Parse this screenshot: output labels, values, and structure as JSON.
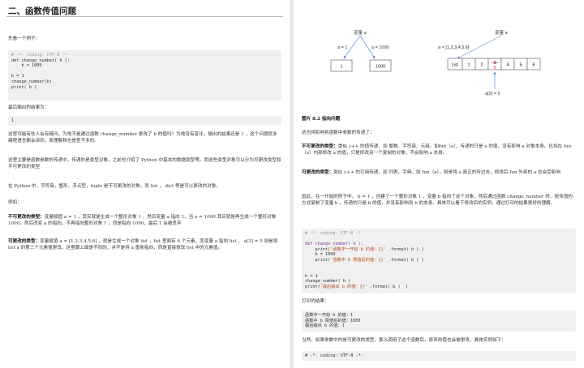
{
  "left": {
    "title": "二、函数传值问题",
    "intro": "先看一个例子：",
    "code1": {
      "comment": "# -*- coding: UTF-8 -*-",
      "lines": [
        "def change_number( b ):",
        "    b = 1000",
        "",
        "b = 1",
        "change_number(b)",
        "print( b )"
      ]
    },
    "result_label": "最后输出的结果为：",
    "result_value": "1",
    "p1": "这里可能有些人会有疑问，为啥不是通过函数 change_number 更改了 b 的值吗？为啥没有变化，输出的结果还是 1 ，这个问题很多编程语言都会讲到，原理解释也是差不多的。",
    "p2": "这里主要是函数参数的传递中，传递的是类型对象，之前也介绍了 Python 中基本的数据类型等。而这些类型对象可以分为可更改类型和不可更改的类型",
    "p3": "在 Python 中，字符串，整形，浮点型，tuple 是不可更改的对象，而 list ， dict 等是可以更改的对象。",
    "p4": "例如：",
    "immut_head": "不可更改的类型：",
    "immut_body": "变量赋值  a = 1 ，其实就是生成一个整形对象 1 ，然后变量 a 指向 1，当 a = 1000 其实就是再生成一个整形对象 1000，然后改变 a 的指向，不再指向整形对象 1 ，而是指向 1000，最后 1 会被丢弃",
    "mut_head": "可更改的类型：",
    "mut_body": "变量赋值  a = [1,2,3,4,5,6] ，就是生成一个对象 list ，list 里面有 6 个元素，而变量 a 指向 list ， a[2] = 5 则是将 list a 的第三个元素值更改，这里跟上面是不同的，并不是将 a 重新指向，而是直接修改 list 中的元素值。"
  },
  "right": {
    "diagram": {
      "var_a_left": "变量 a",
      "a_eq_1": "a = 1",
      "a_eq_1000": "a = 1000",
      "box_1": "1",
      "box_1000": "1000",
      "var_a_right": "变量 a",
      "a_eq_list": "a = [1,2,3,4,5,6]",
      "list_cells": [
        "List",
        "1",
        "2",
        "3",
        "4",
        "5",
        "6"
      ],
      "replaced_value": "5",
      "a2_label": "a[2] = 5"
    },
    "caption": "图片 8.2 指向问题",
    "p1": "这也将影响到函数中参数的传递了：",
    "immut_head": "不可更改的类型：",
    "immut_body": "类似 c++ 的值传递，如 整数、字符串、元组。如fun（a），传递的只是 a 的值，没有影响 a 对象本身。比如在 fun（a）内部修改 a 的值，只是修改另一个复制的对象，不会影响 a 本身。",
    "mut_head": "可更改的类型：",
    "mut_body": "类似 c++ 的引用传递，如 列表，字典。如 fun（a），则是将 a 真正的传过去，修改后 fun 外部的 a 也会受影响",
    "p2": "因此，在一开始的例子中， b = 1 ，创建了一个整形对象 1 ，变量 b 指向了这个对象，然后通过函数 change_number 时，按传值的方式复制了变量 b ，传递的只是 b 的值，并没有影响到 b 的本身。具体可以看下修改后的实例，通过打印的结果更好的理解。",
    "code2": {
      "comment": "# -*- coding: UTF-8 -*-",
      "def_line": "def change_number( b ):",
      "print1_pre": "    print(",
      "print1_str": "'函数中一开始 b 的值：{}'",
      "print1_post": " .format( b ) )",
      "assign": "    b = 1000",
      "print2_pre": "    print(",
      "print2_str": "'函数中 b 赋值后的值：{}'",
      "print2_post": " .format( b ) )",
      "main1": "b = 1",
      "main2": "change_number( b )",
      "print3_pre": "print(",
      "print3_str": "'最后输出 b 的值：{}'",
      "print3_post": " .format( b )  )"
    },
    "out_label": "打印的结果：",
    "output_lines": [
      "函数中一开始 b 的值：1",
      "函数中 b 赋值后的值：1000",
      "最后输出 b 的值：1"
    ],
    "p3": "当然，如果参数中的是可更改的类型，那么调用了这个函数后，原来的值也会被更改，具体实例如下：",
    "code3_comment": "# -*- coding: UTF-8 -*-"
  }
}
